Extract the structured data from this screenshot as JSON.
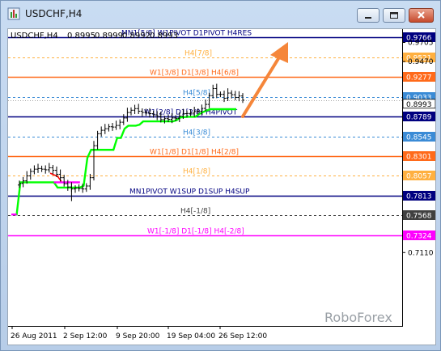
{
  "window": {
    "title": "USDCHF,H4",
    "icon": "chart-icon",
    "buttons": [
      "minimize-icon",
      "restore-icon",
      "close-icon"
    ]
  },
  "chart": {
    "symbol_label": "USDCHF,H4",
    "ohlc": [
      "0.8995",
      "0.8999",
      "0.8992",
      "0.8993"
    ],
    "watermark": "RoboForex",
    "colors": {
      "background": "#ffffff",
      "candles": "#000000",
      "ma": "#00ff00",
      "navy": "#000080",
      "orange": "#ff6a1a",
      "light_orange": "#ffb040",
      "blue": "#3a8bd6",
      "magenta": "#ff00ff",
      "arrow": "#f5863a"
    }
  },
  "chart_data": {
    "type": "candlestick",
    "symbol": "USDCHF",
    "timeframe": "H4",
    "y_ticks": [
      "0.9766",
      "0.9705",
      "0.9521",
      "0.9470",
      "0.9277",
      "0.9033",
      "0.8993",
      "0.8789",
      "0.8545",
      "0.8301",
      "0.8057",
      "0.7813",
      "0.7568",
      "0.7324",
      "0.7110"
    ],
    "ylim": [
      0.711,
      0.98
    ],
    "x_ticks": [
      "26 Aug 2011",
      "2 Sep 12:00",
      "9 Sep 20:00",
      "19 Sep 04:00",
      "26 Sep 12:00"
    ],
    "levels": [
      {
        "price": 0.9766,
        "label": "MN1[5/8] W1PIVOT D1PIVOT H4RES",
        "color": "#000080",
        "style": "solid"
      },
      {
        "price": 0.9521,
        "label": "H4[7/8]",
        "color": "#ffb040",
        "style": "dashed"
      },
      {
        "price": 0.9277,
        "label": "W1[3/8] D1[3/8] H4[6/8]",
        "color": "#ff6a1a",
        "style": "solid"
      },
      {
        "price": 0.9033,
        "label": "H4[5/8]",
        "color": "#3a8bd6",
        "style": "dashed"
      },
      {
        "price": 0.8789,
        "label": "W1[2/8] D1[2/8] H4PIVOT",
        "color": "#000080",
        "style": "solid"
      },
      {
        "price": 0.8545,
        "label": "H4[3/8]",
        "color": "#3a8bd6",
        "style": "dashed"
      },
      {
        "price": 0.8301,
        "label": "W1[1/8] D1[1/8] H4[2/8]",
        "color": "#ff6a1a",
        "style": "solid"
      },
      {
        "price": 0.8057,
        "label": "H4[1/8]",
        "color": "#ffb040",
        "style": "dashed"
      },
      {
        "price": 0.7813,
        "label": "MN1PIVOT W1SUP D1SUP H4SUP",
        "color": "#000080",
        "style": "solid"
      },
      {
        "price": 0.7568,
        "label": "H4[-1/8]",
        "color": "#404040",
        "style": "dashed"
      },
      {
        "price": 0.7324,
        "label": "W1[-1/8] D1[-1/8] H4[-2/8]",
        "color": "#ff00ff",
        "style": "solid"
      }
    ],
    "current_price": 0.8993,
    "price_series": [
      0.7964,
      0.7996,
      0.8057,
      0.8112,
      0.814,
      0.8148,
      0.814,
      0.8132,
      0.8157,
      0.8126,
      0.8077,
      0.8035,
      0.796,
      0.792,
      0.7895,
      0.7905,
      0.7901,
      0.7895,
      0.7932,
      0.8035,
      0.843,
      0.8578,
      0.862,
      0.864,
      0.8664,
      0.866,
      0.868,
      0.872,
      0.8772,
      0.884,
      0.8868,
      0.8888,
      0.8856,
      0.884,
      0.8834,
      0.8826,
      0.881,
      0.8792,
      0.8752,
      0.8764,
      0.8756,
      0.8772,
      0.8768,
      0.8796,
      0.8826,
      0.8828,
      0.8832,
      0.8852,
      0.8856,
      0.8891,
      0.894,
      0.9048,
      0.9136,
      0.9064,
      0.9064,
      0.9016,
      0.908,
      0.906,
      0.9026,
      0.9044,
      0.8993
    ],
    "ma_series": [
      0.758,
      0.758,
      0.7977,
      0.7977,
      0.7977,
      0.7977,
      0.7977,
      0.7977,
      0.7977,
      0.7977,
      0.7977,
      0.7977,
      0.7912,
      0.7912,
      0.7912,
      0.7912,
      0.7912,
      0.7912,
      0.7912,
      0.7936,
      0.828,
      0.8379,
      0.8379,
      0.8379,
      0.8379,
      0.8379,
      0.8379,
      0.8379,
      0.8526,
      0.8526,
      0.864,
      0.8677,
      0.8677,
      0.8677,
      0.8689,
      0.873,
      0.873,
      0.873,
      0.873,
      0.873,
      0.873,
      0.873,
      0.873,
      0.873,
      0.8746,
      0.8779,
      0.8783,
      0.8787,
      0.8787,
      0.8787,
      0.882,
      0.8844,
      0.8864,
      0.8881,
      0.8881,
      0.8881,
      0.8881,
      0.8881,
      0.8881,
      0.8881,
      0.8881
    ]
  }
}
